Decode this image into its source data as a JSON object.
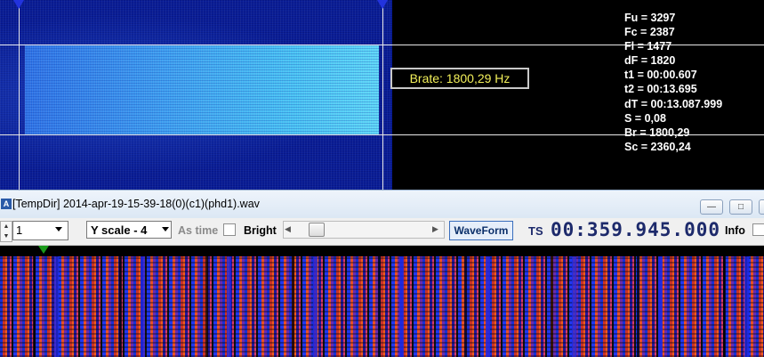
{
  "readout": {
    "fu": "Fu = 3297",
    "fc": "Fc = 2387",
    "fl": "Fl = 1477",
    "df": "dF = 1820",
    "t1": "t1 = 00:00.607",
    "t2": "t2 = 00:13.695",
    "dt": "dT = 00:13.087.999",
    "s": "S = 0,08",
    "br": "Br = 1800,29",
    "sc": "Sc = 2360,24"
  },
  "brate_label": "Brate: 1800,29 Hz",
  "window": {
    "title": "[TempDir] 2014-apr-19-15-39-18(0)(c1)(phd1).wav",
    "app_icon": "A",
    "minimize_icon": "minimize-icon",
    "restore_icon": "restore-icon",
    "close_icon": "close-icon"
  },
  "toolbar": {
    "channel_value": "1",
    "yscale_value": "Y scale - 4",
    "as_time_label": "As time",
    "bright_label": "Bright",
    "bright_checked": false,
    "waveform_label": "WaveForm",
    "ts_label": "TS",
    "ts_value": "00:359.945.000",
    "info_label": "Info",
    "info_checked": false
  },
  "colors": {
    "spectrogram_bg": "#0a1f9a",
    "signal_block": "#45c2f4",
    "brate_text": "#f2ef5a",
    "ts_text": "#1d2a6b",
    "cursor_marker": "#2233dd",
    "play_marker": "#1a9a1a"
  }
}
